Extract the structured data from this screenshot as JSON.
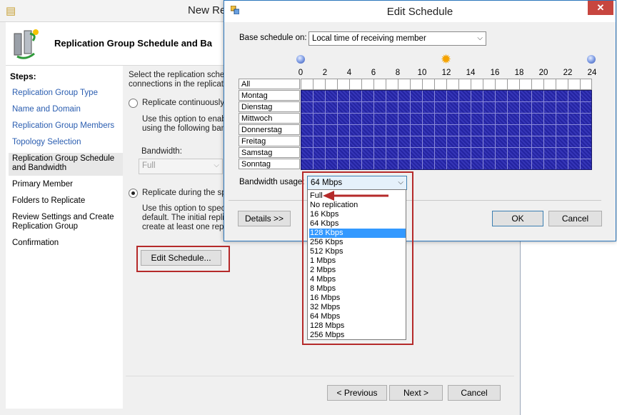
{
  "wizard": {
    "title": "New Re",
    "header_title": "Replication Group Schedule and Ba",
    "steps_title": "Steps:",
    "steps": [
      {
        "label": "Replication Group Type"
      },
      {
        "label": "Name and Domain"
      },
      {
        "label": "Replication Group Members"
      },
      {
        "label": "Topology Selection"
      },
      {
        "label": "Replication Group Schedule and Bandwidth"
      },
      {
        "label": "Primary Member"
      },
      {
        "label": "Folders to Replicate"
      },
      {
        "label": "Review Settings and Create Replication Group"
      },
      {
        "label": "Confirmation"
      }
    ],
    "intro_line1": "Select the replication schedu",
    "intro_line2": "connections in the replicatio",
    "option1_label": "Replicate continuously u",
    "option1_desc1": "Use this option to enable",
    "option1_desc2": "using the following band",
    "bandwidth_label": "Bandwidth:",
    "bandwidth_value": "Full",
    "option2_label": "Replicate during the spe",
    "option2_desc1": "Use this option to specify",
    "option2_desc2": "default. The initial replica",
    "option2_desc3": "create at least one replic",
    "edit_schedule_button": "Edit Schedule...",
    "previous_button": "< Previous",
    "next_button": "Next >",
    "cancel_button": "Cancel"
  },
  "dialog": {
    "title": "Edit Schedule",
    "close_glyph": "✕",
    "base_label": "Base schedule on:",
    "base_value": "Local time of receiving member",
    "hour_ticks": [
      "0",
      "2",
      "4",
      "6",
      "8",
      "10",
      "12",
      "14",
      "16",
      "18",
      "20",
      "22",
      "24"
    ],
    "all_label": "All",
    "days": [
      "Montag",
      "Dienstag",
      "Mittwoch",
      "Donnerstag",
      "Freitag",
      "Samstag",
      "Sonntag"
    ],
    "bandwidth_label": "Bandwidth usage:",
    "bandwidth_value": "64 Mbps",
    "details_button": "Details >>",
    "ok_button": "OK",
    "cancel_button": "Cancel"
  },
  "dropdown": {
    "options": [
      "Full",
      "No replication",
      "16 Kbps",
      "64 Kbps",
      "128 Kbps",
      "256 Kbps",
      "512 Kbps",
      "1 Mbps",
      "2 Mbps",
      "4 Mbps",
      "8 Mbps",
      "16 Mbps",
      "32 Mbps",
      "64 Mbps",
      "128 Mbps",
      "256 Mbps"
    ],
    "selected_option": "128 Kbps"
  },
  "colors": {
    "schedule_fill": "#2a2aa8",
    "highlight_box": "#b52a2a",
    "selection": "#3399ff",
    "link": "#2a5db0"
  }
}
